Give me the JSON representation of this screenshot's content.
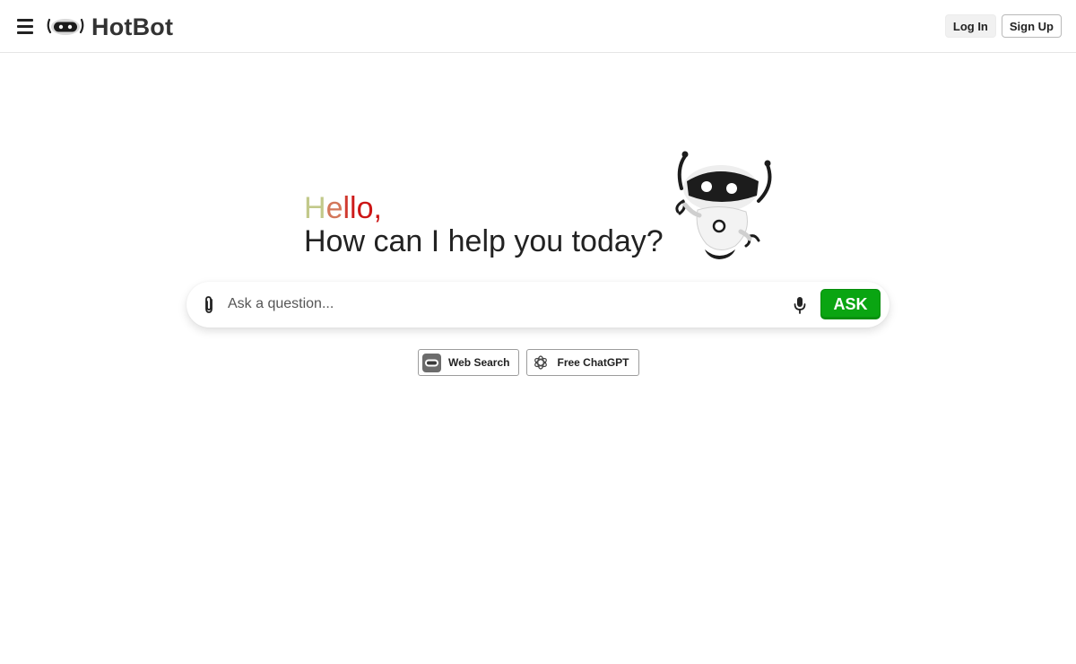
{
  "header": {
    "logo_text": "HotBot",
    "login_label": "Log In",
    "signup_label": "Sign Up"
  },
  "hero": {
    "hello_letters": [
      "H",
      "e",
      "l",
      "l",
      "o",
      ","
    ],
    "hello_colors": [
      "#c2c98a",
      "#d3775a",
      "#d0392f",
      "#cd1c1c",
      "#cc1515",
      "#cc1515"
    ],
    "subline": "How can I help you today?"
  },
  "search": {
    "placeholder": "Ask a question...",
    "value": "",
    "ask_label": "ASK"
  },
  "chips": [
    {
      "label": "Web Search",
      "icon": "hotbot-robot-icon"
    },
    {
      "label": "Free ChatGPT",
      "icon": "openai-icon"
    }
  ],
  "colors": {
    "ask_button": "#0aa512",
    "text": "#222222",
    "header_border": "#e6e6e6"
  }
}
